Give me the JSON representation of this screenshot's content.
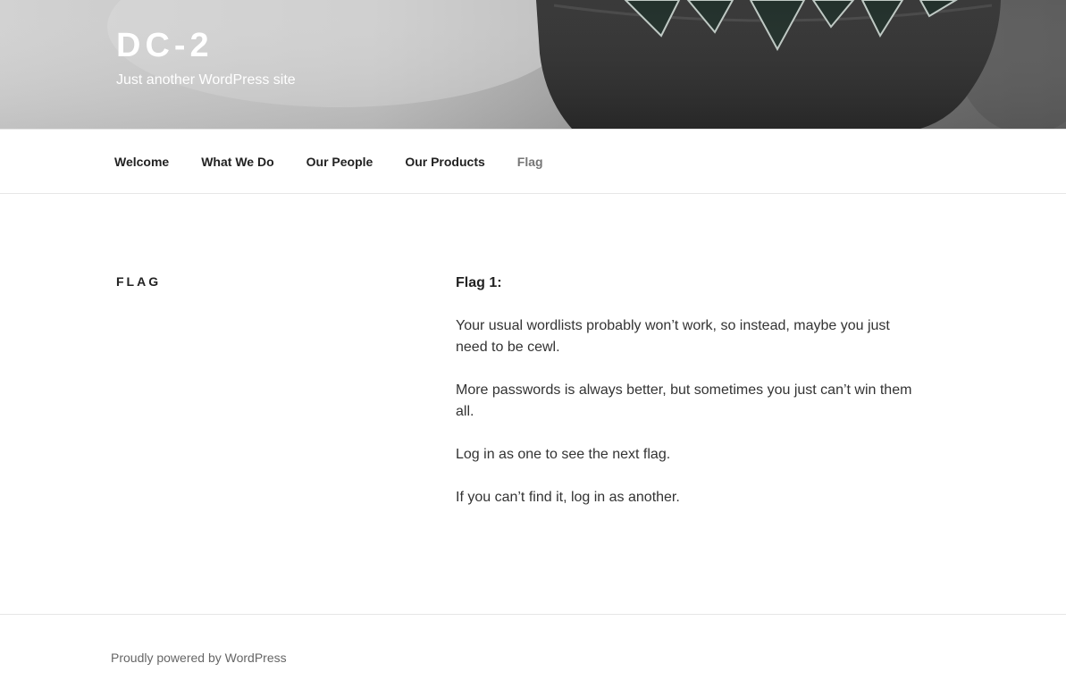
{
  "header": {
    "site_title": "DC-2",
    "site_description": "Just another WordPress site"
  },
  "nav": {
    "items": [
      {
        "label": "Welcome"
      },
      {
        "label": "What We Do"
      },
      {
        "label": "Our People"
      },
      {
        "label": "Our Products"
      },
      {
        "label": "Flag"
      }
    ]
  },
  "page": {
    "title": "FLAG",
    "paragraphs": [
      "Flag 1:",
      "Your usual wordlists probably won’t work, so instead, maybe you just need to be cewl.",
      "More passwords is always better, but sometimes you just can’t win them all.",
      "Log in as one to see the next flag.",
      "If you can’t find it, log in as another."
    ]
  },
  "footer": {
    "credit": "Proudly powered by WordPress"
  },
  "colors": {
    "text": "#222222",
    "nav_current": "#767676",
    "footer_text": "#666666"
  }
}
